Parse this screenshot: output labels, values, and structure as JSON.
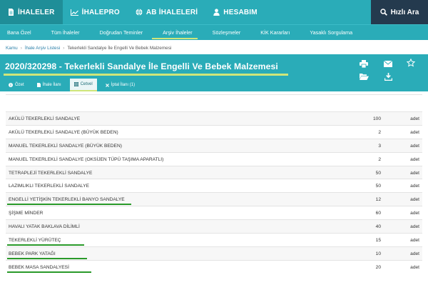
{
  "topnav": {
    "tabs": [
      {
        "label": "İHALELER",
        "icon": "document-icon",
        "active": true
      },
      {
        "label": "İHALEPRO",
        "icon": "chart-icon",
        "active": false
      },
      {
        "label": "AB İHALELERİ",
        "icon": "globe-icon",
        "active": false
      },
      {
        "label": "HESABIM",
        "icon": "user-icon",
        "active": false
      }
    ],
    "quick_search": "Hızlı Ara"
  },
  "subnav": {
    "items": [
      {
        "label": "Bana Özel",
        "active": false
      },
      {
        "label": "Tüm İhaleler",
        "active": false
      },
      {
        "label": "Doğrudan Teminler",
        "active": false
      },
      {
        "label": "Arşiv İhaleler",
        "active": true
      },
      {
        "label": "Sözleşmeler",
        "active": false
      },
      {
        "label": "KİK Kararları",
        "active": false
      },
      {
        "label": "Yasaklı Sorgulama",
        "active": false
      }
    ]
  },
  "breadcrumb": [
    "Kamu",
    "İhale Arşiv Listesi",
    "Tekerlekli Sandalye İle Engelli Ve Bebek Malzemesi"
  ],
  "tender": {
    "title": "2020/320298 - Tekerlekli Sandalye İle Engelli Ve Bebek Malzemesi",
    "tabs": [
      {
        "label": "Özet",
        "icon": "info-icon",
        "active": false
      },
      {
        "label": "İhale İlanı",
        "icon": "file-icon",
        "active": false
      },
      {
        "label": "Cetvel",
        "icon": "table-icon",
        "active": true
      },
      {
        "label": "İptal İlanı (1)",
        "icon": "cross-icon",
        "active": false
      }
    ]
  },
  "colors": {
    "primary": "#2aacb8",
    "primary_dark": "#1f8e98",
    "quick_bg": "#243a4e",
    "highlight": "#cfe67a",
    "underline_mark": "#2a9a2a"
  },
  "items": [
    {
      "name": "AKÜLÜ TEKERLEKLİ SANDALYE",
      "qty": "100",
      "unit": "adet",
      "marked": false
    },
    {
      "name": "AKÜLÜ TEKERLEKLİ SANDALYE (BÜYÜK BEDEN)",
      "qty": "2",
      "unit": "adet",
      "marked": false
    },
    {
      "name": "MANUEL TEKERLEKLİ SANDALYE (BÜYÜK BEDEN)",
      "qty": "3",
      "unit": "adet",
      "marked": false
    },
    {
      "name": "MANUEL TEKERLEKLİ SANDALYE (OKSİJEN TÜPÜ TAŞIMA APARATLI)",
      "qty": "2",
      "unit": "adet",
      "marked": false
    },
    {
      "name": "TETRAPLEJİ TEKERLEKLİ SANDALYE",
      "qty": "50",
      "unit": "adet",
      "marked": false
    },
    {
      "name": "LAZIMLIKLI TEKERLEKLİ SANDALYE",
      "qty": "50",
      "unit": "adet",
      "marked": false
    },
    {
      "name": "ENGELLİ YETİŞKİN TEKERLEKLİ BANYO SANDALYE",
      "qty": "12",
      "unit": "adet",
      "marked": true
    },
    {
      "name": "ŞİŞME MİNDER",
      "qty": "60",
      "unit": "adet",
      "marked": false
    },
    {
      "name": "HAVALI YATAK BAKLAVA DİLİMLİ",
      "qty": "40",
      "unit": "adet",
      "marked": false
    },
    {
      "name": "TEKERLEKLİ YÜRÜTEÇ",
      "qty": "15",
      "unit": "adet",
      "marked": true
    },
    {
      "name": "BEBEK PARK YATAĞI",
      "qty": "10",
      "unit": "adet",
      "marked": true
    },
    {
      "name": "BEBEK MASA SANDALYESİ",
      "qty": "20",
      "unit": "adet",
      "marked": true
    }
  ]
}
